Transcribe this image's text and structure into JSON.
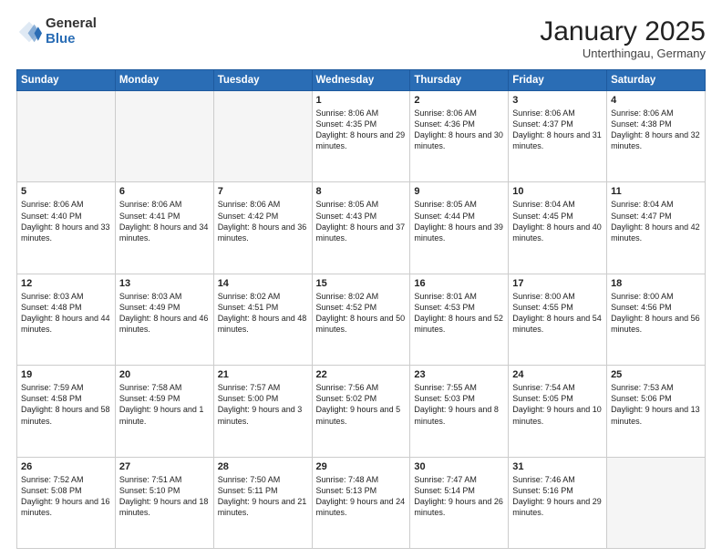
{
  "logo": {
    "general": "General",
    "blue": "Blue"
  },
  "header": {
    "title": "January 2025",
    "subtitle": "Unterthingau, Germany"
  },
  "weekdays": [
    "Sunday",
    "Monday",
    "Tuesday",
    "Wednesday",
    "Thursday",
    "Friday",
    "Saturday"
  ],
  "weeks": [
    [
      {
        "day": "",
        "info": ""
      },
      {
        "day": "",
        "info": ""
      },
      {
        "day": "",
        "info": ""
      },
      {
        "day": "1",
        "info": "Sunrise: 8:06 AM\nSunset: 4:35 PM\nDaylight: 8 hours and 29 minutes."
      },
      {
        "day": "2",
        "info": "Sunrise: 8:06 AM\nSunset: 4:36 PM\nDaylight: 8 hours and 30 minutes."
      },
      {
        "day": "3",
        "info": "Sunrise: 8:06 AM\nSunset: 4:37 PM\nDaylight: 8 hours and 31 minutes."
      },
      {
        "day": "4",
        "info": "Sunrise: 8:06 AM\nSunset: 4:38 PM\nDaylight: 8 hours and 32 minutes."
      }
    ],
    [
      {
        "day": "5",
        "info": "Sunrise: 8:06 AM\nSunset: 4:40 PM\nDaylight: 8 hours and 33 minutes."
      },
      {
        "day": "6",
        "info": "Sunrise: 8:06 AM\nSunset: 4:41 PM\nDaylight: 8 hours and 34 minutes."
      },
      {
        "day": "7",
        "info": "Sunrise: 8:06 AM\nSunset: 4:42 PM\nDaylight: 8 hours and 36 minutes."
      },
      {
        "day": "8",
        "info": "Sunrise: 8:05 AM\nSunset: 4:43 PM\nDaylight: 8 hours and 37 minutes."
      },
      {
        "day": "9",
        "info": "Sunrise: 8:05 AM\nSunset: 4:44 PM\nDaylight: 8 hours and 39 minutes."
      },
      {
        "day": "10",
        "info": "Sunrise: 8:04 AM\nSunset: 4:45 PM\nDaylight: 8 hours and 40 minutes."
      },
      {
        "day": "11",
        "info": "Sunrise: 8:04 AM\nSunset: 4:47 PM\nDaylight: 8 hours and 42 minutes."
      }
    ],
    [
      {
        "day": "12",
        "info": "Sunrise: 8:03 AM\nSunset: 4:48 PM\nDaylight: 8 hours and 44 minutes."
      },
      {
        "day": "13",
        "info": "Sunrise: 8:03 AM\nSunset: 4:49 PM\nDaylight: 8 hours and 46 minutes."
      },
      {
        "day": "14",
        "info": "Sunrise: 8:02 AM\nSunset: 4:51 PM\nDaylight: 8 hours and 48 minutes."
      },
      {
        "day": "15",
        "info": "Sunrise: 8:02 AM\nSunset: 4:52 PM\nDaylight: 8 hours and 50 minutes."
      },
      {
        "day": "16",
        "info": "Sunrise: 8:01 AM\nSunset: 4:53 PM\nDaylight: 8 hours and 52 minutes."
      },
      {
        "day": "17",
        "info": "Sunrise: 8:00 AM\nSunset: 4:55 PM\nDaylight: 8 hours and 54 minutes."
      },
      {
        "day": "18",
        "info": "Sunrise: 8:00 AM\nSunset: 4:56 PM\nDaylight: 8 hours and 56 minutes."
      }
    ],
    [
      {
        "day": "19",
        "info": "Sunrise: 7:59 AM\nSunset: 4:58 PM\nDaylight: 8 hours and 58 minutes."
      },
      {
        "day": "20",
        "info": "Sunrise: 7:58 AM\nSunset: 4:59 PM\nDaylight: 9 hours and 1 minute."
      },
      {
        "day": "21",
        "info": "Sunrise: 7:57 AM\nSunset: 5:00 PM\nDaylight: 9 hours and 3 minutes."
      },
      {
        "day": "22",
        "info": "Sunrise: 7:56 AM\nSunset: 5:02 PM\nDaylight: 9 hours and 5 minutes."
      },
      {
        "day": "23",
        "info": "Sunrise: 7:55 AM\nSunset: 5:03 PM\nDaylight: 9 hours and 8 minutes."
      },
      {
        "day": "24",
        "info": "Sunrise: 7:54 AM\nSunset: 5:05 PM\nDaylight: 9 hours and 10 minutes."
      },
      {
        "day": "25",
        "info": "Sunrise: 7:53 AM\nSunset: 5:06 PM\nDaylight: 9 hours and 13 minutes."
      }
    ],
    [
      {
        "day": "26",
        "info": "Sunrise: 7:52 AM\nSunset: 5:08 PM\nDaylight: 9 hours and 16 minutes."
      },
      {
        "day": "27",
        "info": "Sunrise: 7:51 AM\nSunset: 5:10 PM\nDaylight: 9 hours and 18 minutes."
      },
      {
        "day": "28",
        "info": "Sunrise: 7:50 AM\nSunset: 5:11 PM\nDaylight: 9 hours and 21 minutes."
      },
      {
        "day": "29",
        "info": "Sunrise: 7:48 AM\nSunset: 5:13 PM\nDaylight: 9 hours and 24 minutes."
      },
      {
        "day": "30",
        "info": "Sunrise: 7:47 AM\nSunset: 5:14 PM\nDaylight: 9 hours and 26 minutes."
      },
      {
        "day": "31",
        "info": "Sunrise: 7:46 AM\nSunset: 5:16 PM\nDaylight: 9 hours and 29 minutes."
      },
      {
        "day": "",
        "info": ""
      }
    ]
  ]
}
